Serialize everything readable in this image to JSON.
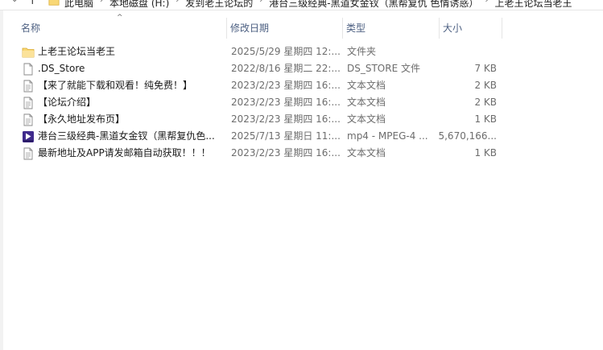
{
  "address": {
    "crumbs": [
      "此电脑",
      "本地磁盘 (H:)",
      "发到老王论坛的",
      "港台三级经典-黑道女金钗（黑帮复仇 色情诱惑）",
      "上老王论坛当老王"
    ]
  },
  "columns": {
    "name": "名称",
    "date": "修改日期",
    "type": "类型",
    "size": "大小"
  },
  "files": [
    {
      "name": "上老王论坛当老王",
      "date": "2025/5/29 星期四 12:...",
      "type": "文件夹",
      "size": "",
      "icon": "folder-icon"
    },
    {
      "name": ".DS_Store",
      "date": "2022/8/16 星期二 22:...",
      "type": "DS_STORE 文件",
      "size": "7 KB",
      "icon": "file-icon"
    },
    {
      "name": "【来了就能下载和观看！纯免费！】",
      "date": "2023/2/23 星期四 16:...",
      "type": "文本文档",
      "size": "2 KB",
      "icon": "text-file-icon"
    },
    {
      "name": "【论坛介绍】",
      "date": "2023/2/23 星期四 16:...",
      "type": "文本文档",
      "size": "2 KB",
      "icon": "text-file-icon"
    },
    {
      "name": "【永久地址发布页】",
      "date": "2023/2/23 星期四 16:...",
      "type": "文本文档",
      "size": "1 KB",
      "icon": "text-file-icon"
    },
    {
      "name": "港台三级经典-黑道女金钗（黑帮复仇色...",
      "date": "2025/7/13 星期日 11:...",
      "type": "mp4 - MPEG-4 ...",
      "size": "5,670,166...",
      "icon": "video-file-icon"
    },
    {
      "name": "最新地址及APP请发邮箱自动获取！！！",
      "date": "2023/2/23 星期四 16:...",
      "type": "文本文档",
      "size": "1 KB",
      "icon": "text-file-icon"
    }
  ]
}
